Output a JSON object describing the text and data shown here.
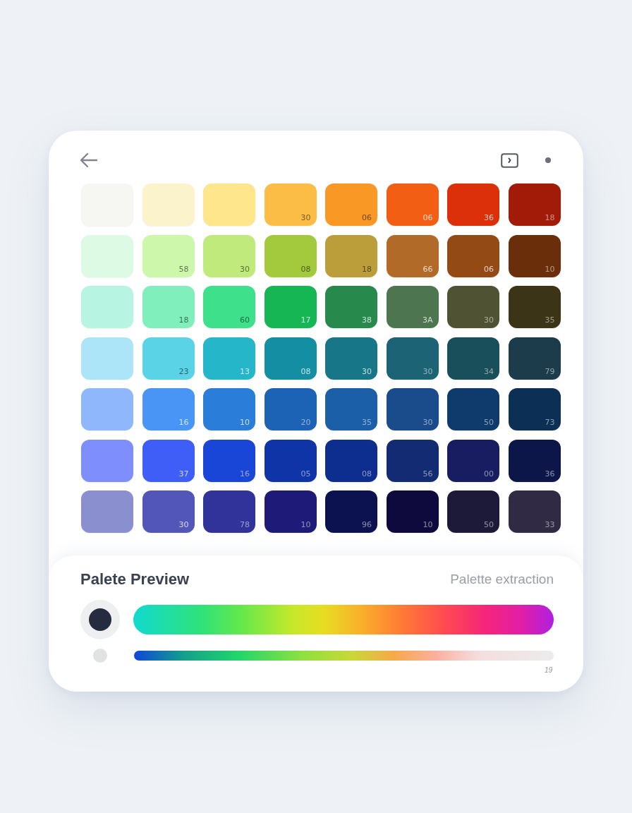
{
  "grid": {
    "rows": [
      {
        "swatches": [
          {
            "color": "#f6f6f2"
          },
          {
            "color": "#fbf3cc"
          },
          {
            "color": "#fde68c"
          },
          {
            "color": "#fbbd45",
            "label": "30"
          },
          {
            "color": "#fa9826",
            "label": "06"
          },
          {
            "color": "#f25f14",
            "label": "06"
          },
          {
            "color": "#dc300a",
            "label": "36"
          },
          {
            "color": "#a21a08",
            "label": "18"
          }
        ]
      },
      {
        "swatches": [
          {
            "color": "#ddfae4"
          },
          {
            "color": "#cdf8ac",
            "label": "58"
          },
          {
            "color": "#c1ea7c",
            "label": "30"
          },
          {
            "color": "#a3c93c",
            "label": "08"
          },
          {
            "color": "#bb9d3a",
            "label": "18"
          },
          {
            "color": "#b26a28",
            "label": "66"
          },
          {
            "color": "#944a15",
            "label": "06"
          },
          {
            "color": "#6b2e0a",
            "label": "10"
          }
        ]
      },
      {
        "swatches": [
          {
            "color": "#b7f5e2"
          },
          {
            "color": "#80efbc",
            "label": "18"
          },
          {
            "color": "#3ee08c",
            "label": "60"
          },
          {
            "color": "#17b655",
            "label": "17"
          },
          {
            "color": "#278a4c",
            "label": "38"
          },
          {
            "color": "#4d7550",
            "label": "3A"
          },
          {
            "color": "#4f5334",
            "label": "30"
          },
          {
            "color": "#3b3416",
            "label": "35"
          }
        ]
      },
      {
        "swatches": [
          {
            "color": "#ace4f8"
          },
          {
            "color": "#5ad3e6",
            "label": "23"
          },
          {
            "color": "#26b6c9",
            "label": "13"
          },
          {
            "color": "#148ea3",
            "label": "08"
          },
          {
            "color": "#177789",
            "label": "30"
          },
          {
            "color": "#1c6475",
            "label": "30"
          },
          {
            "color": "#184f5b",
            "label": "34"
          },
          {
            "color": "#1d3c4b",
            "label": "79"
          }
        ]
      },
      {
        "swatches": [
          {
            "color": "#8fb8fc"
          },
          {
            "color": "#4995f6",
            "label": "16"
          },
          {
            "color": "#2a7dd8",
            "label": "10"
          },
          {
            "color": "#1c63b5",
            "label": "20"
          },
          {
            "color": "#1b5fa8",
            "label": "35"
          },
          {
            "color": "#1a4b8a",
            "label": "30"
          },
          {
            "color": "#0f3a6c",
            "label": "50"
          },
          {
            "color": "#0c2f55",
            "label": "73"
          }
        ]
      },
      {
        "swatches": [
          {
            "color": "#7e8efc"
          },
          {
            "color": "#3f5ef8",
            "label": "37"
          },
          {
            "color": "#1a46d8",
            "label": "16"
          },
          {
            "color": "#0e34a8",
            "label": "05"
          },
          {
            "color": "#0e2e8f",
            "label": "08"
          },
          {
            "color": "#132b72",
            "label": "56"
          },
          {
            "color": "#181c61",
            "label": "00"
          },
          {
            "color": "#0d1648",
            "label": "36"
          }
        ]
      },
      {
        "swatches": [
          {
            "color": "#8a8fd0"
          },
          {
            "color": "#5256b8",
            "label": "30"
          },
          {
            "color": "#31339a",
            "label": "78"
          },
          {
            "color": "#1d1a78",
            "label": "10"
          },
          {
            "color": "#0c1250",
            "label": "96"
          },
          {
            "color": "#0f0a3e",
            "label": "10"
          },
          {
            "color": "#1c1a38",
            "label": "50"
          },
          {
            "color": "#302a44",
            "label": "33"
          }
        ]
      }
    ]
  },
  "preview": {
    "title": "Palete Preview",
    "subtitle": "Palette extraction",
    "rows": [
      {
        "kind": "rainbow",
        "selected": true
      },
      {
        "kind": "spectrum",
        "selected": false
      }
    ],
    "footnote": "19"
  }
}
